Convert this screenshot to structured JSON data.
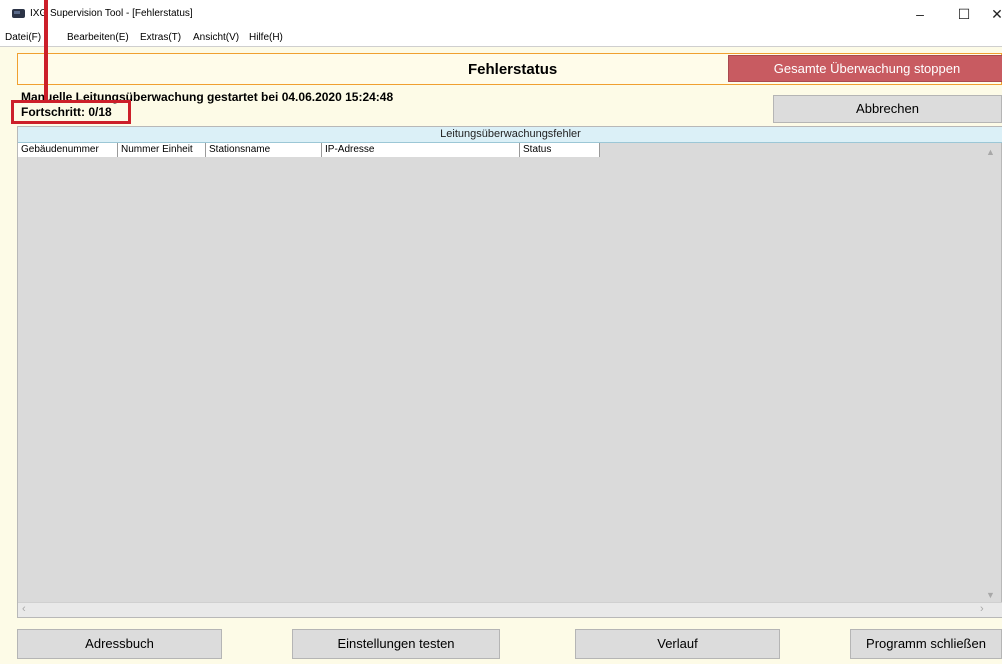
{
  "window": {
    "title": "IXG Supervision Tool - [Fehlerstatus]",
    "min_glyph": "–",
    "max_glyph": "☐",
    "close_glyph": "✕"
  },
  "menu": {
    "items": [
      {
        "label": "Datei(F)"
      },
      {
        "label": "Bearbeiten(E)"
      },
      {
        "label": "Extras(T)"
      },
      {
        "label": "Ansicht(V)"
      },
      {
        "label": "Hilfe(H)"
      }
    ]
  },
  "header": {
    "title": "Fehlerstatus",
    "stop_button": "Gesamte Überwachung stoppen"
  },
  "status": {
    "started": "Manuelle Leitungsüberwachung gestartet bei 04.06.2020 15:24:48",
    "progress": "Fortschritt: 0/18",
    "progress_fraction": 0.0
  },
  "cancel_button": "Abbrechen",
  "table": {
    "caption": "Leitungsüberwachungsfehler",
    "columns": [
      "Gebäudenummer",
      "Nummer Einheit",
      "Stationsname",
      "IP-Adresse",
      "Status"
    ],
    "rows": []
  },
  "scroll": {
    "up": "▲",
    "down": "▼",
    "left": "‹",
    "right": "›"
  },
  "bottom_buttons": {
    "address_book": "Adressbuch",
    "test_settings": "Einstellungen testen",
    "history": "Verlauf",
    "close_program": "Programm schließen"
  },
  "colors": {
    "stop_button_bg": "#c85b61",
    "highlight_border": "#cc1f2a",
    "panel_bg": "#fdfbe7",
    "caption_bg": "#dbf0f7"
  }
}
